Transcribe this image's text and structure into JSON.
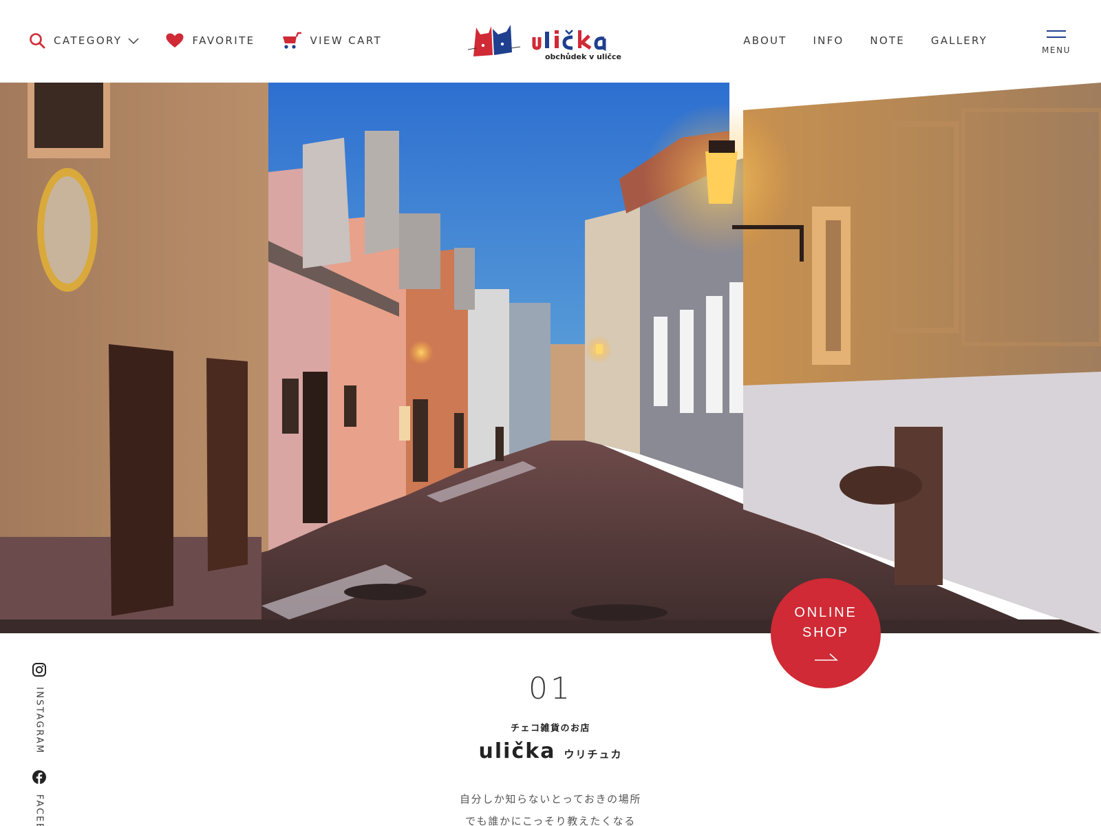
{
  "header": {
    "left_nav": [
      {
        "label": "CATEGORY",
        "icon": "search-icon"
      },
      {
        "label": "FAVORITE",
        "icon": "heart-icon"
      },
      {
        "label": "VIEW CART",
        "icon": "cart-icon"
      }
    ],
    "logo": {
      "wordmark": "ulička",
      "tagline": "obchůdek v uličce"
    },
    "right_nav": [
      "ABOUT",
      "INFO",
      "NOTE",
      "GALLERY"
    ],
    "menu_label": "MENU"
  },
  "hero": {
    "alt": "Golden Lane street at dusk with lanterns",
    "cta": {
      "line1": "ONLINE",
      "line2": "SHOP",
      "icon": "arrow-right-icon"
    }
  },
  "social": [
    {
      "label": "INSTAGRAM",
      "icon": "instagram-icon"
    },
    {
      "label": "FACEBOOK",
      "icon": "facebook-icon"
    }
  ],
  "section": {
    "number": "01",
    "subtitle": "チェコ雑貨のお店",
    "brand_name": "ulička",
    "brand_kana": "ウリチュカ",
    "lines": [
      "自分しか知らないとっておきの場所",
      "でも誰かにこっそり教えたくなる"
    ]
  },
  "colors": {
    "accent_red": "#cf2a35",
    "accent_blue": "#1f3f8f",
    "text": "#3a3a3a"
  }
}
